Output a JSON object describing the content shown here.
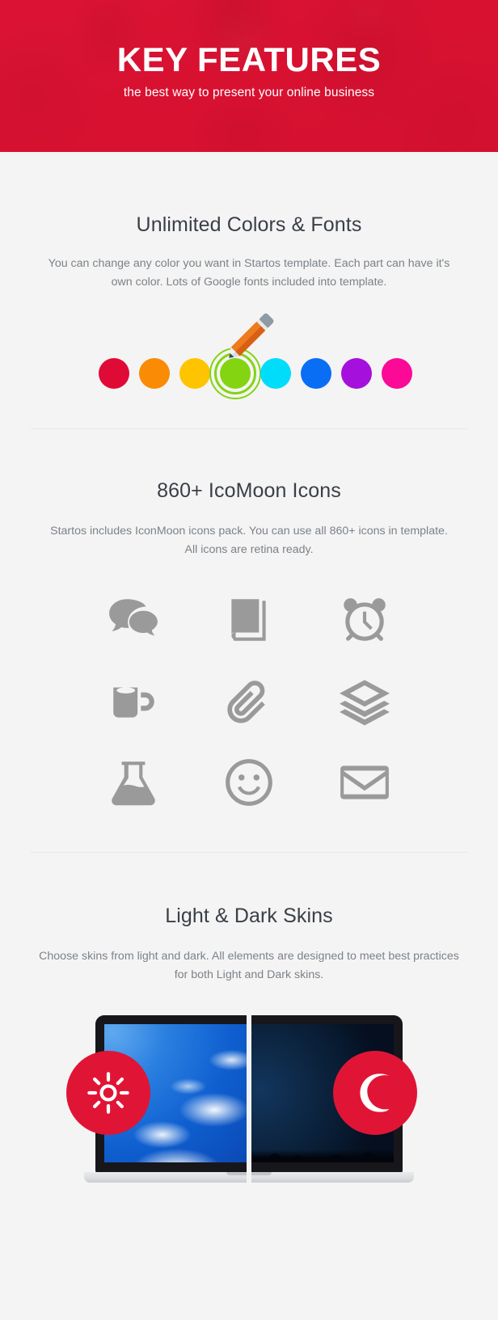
{
  "hero": {
    "title": "KEY FEATURES",
    "subtitle": "the best way to present your online business",
    "bg_color": "#d91232"
  },
  "sections": [
    {
      "id": "colors",
      "title": "Unlimited Colors & Fonts",
      "description": "You can change any color you want in Startos template. Each part can have it's own color. Lots of Google fonts included into template.",
      "swatches": [
        {
          "name": "crimson",
          "color": "#e00a37",
          "selected": false
        },
        {
          "name": "orange",
          "color": "#fa8b05",
          "selected": false
        },
        {
          "name": "amber",
          "color": "#ffc400",
          "selected": false
        },
        {
          "name": "green",
          "color": "#84d412",
          "selected": true
        },
        {
          "name": "cyan",
          "color": "#00dcfa",
          "selected": false
        },
        {
          "name": "blue",
          "color": "#0a6ef5",
          "selected": false
        },
        {
          "name": "purple",
          "color": "#a510dd",
          "selected": false
        },
        {
          "name": "magenta",
          "color": "#fa0a96",
          "selected": false
        }
      ],
      "pencil_icon": "pencil-icon"
    },
    {
      "id": "icons",
      "title": "860+ IcoMoon Icons",
      "description": "Startos includes IconMoon icons pack. You can use all 860+ icons in template. All icons are retina ready.",
      "icon_color": "#9a9a9a",
      "icons": [
        "chat-bubbles-icon",
        "book-icon",
        "alarm-clock-icon",
        "coffee-mug-icon",
        "paperclip-icon",
        "layers-icon",
        "flask-icon",
        "smiley-face-icon",
        "envelope-icon"
      ]
    },
    {
      "id": "skins",
      "title": "Light & Dark Skins",
      "description": "Choose skins from light and dark. All elements are designed to meet best practices for both Light and Dark skins.",
      "badges": [
        {
          "name": "sun-icon",
          "label": "Light skin",
          "color": "#e01535"
        },
        {
          "name": "moon-icon",
          "label": "Dark skin",
          "color": "#e01535"
        }
      ]
    }
  ]
}
